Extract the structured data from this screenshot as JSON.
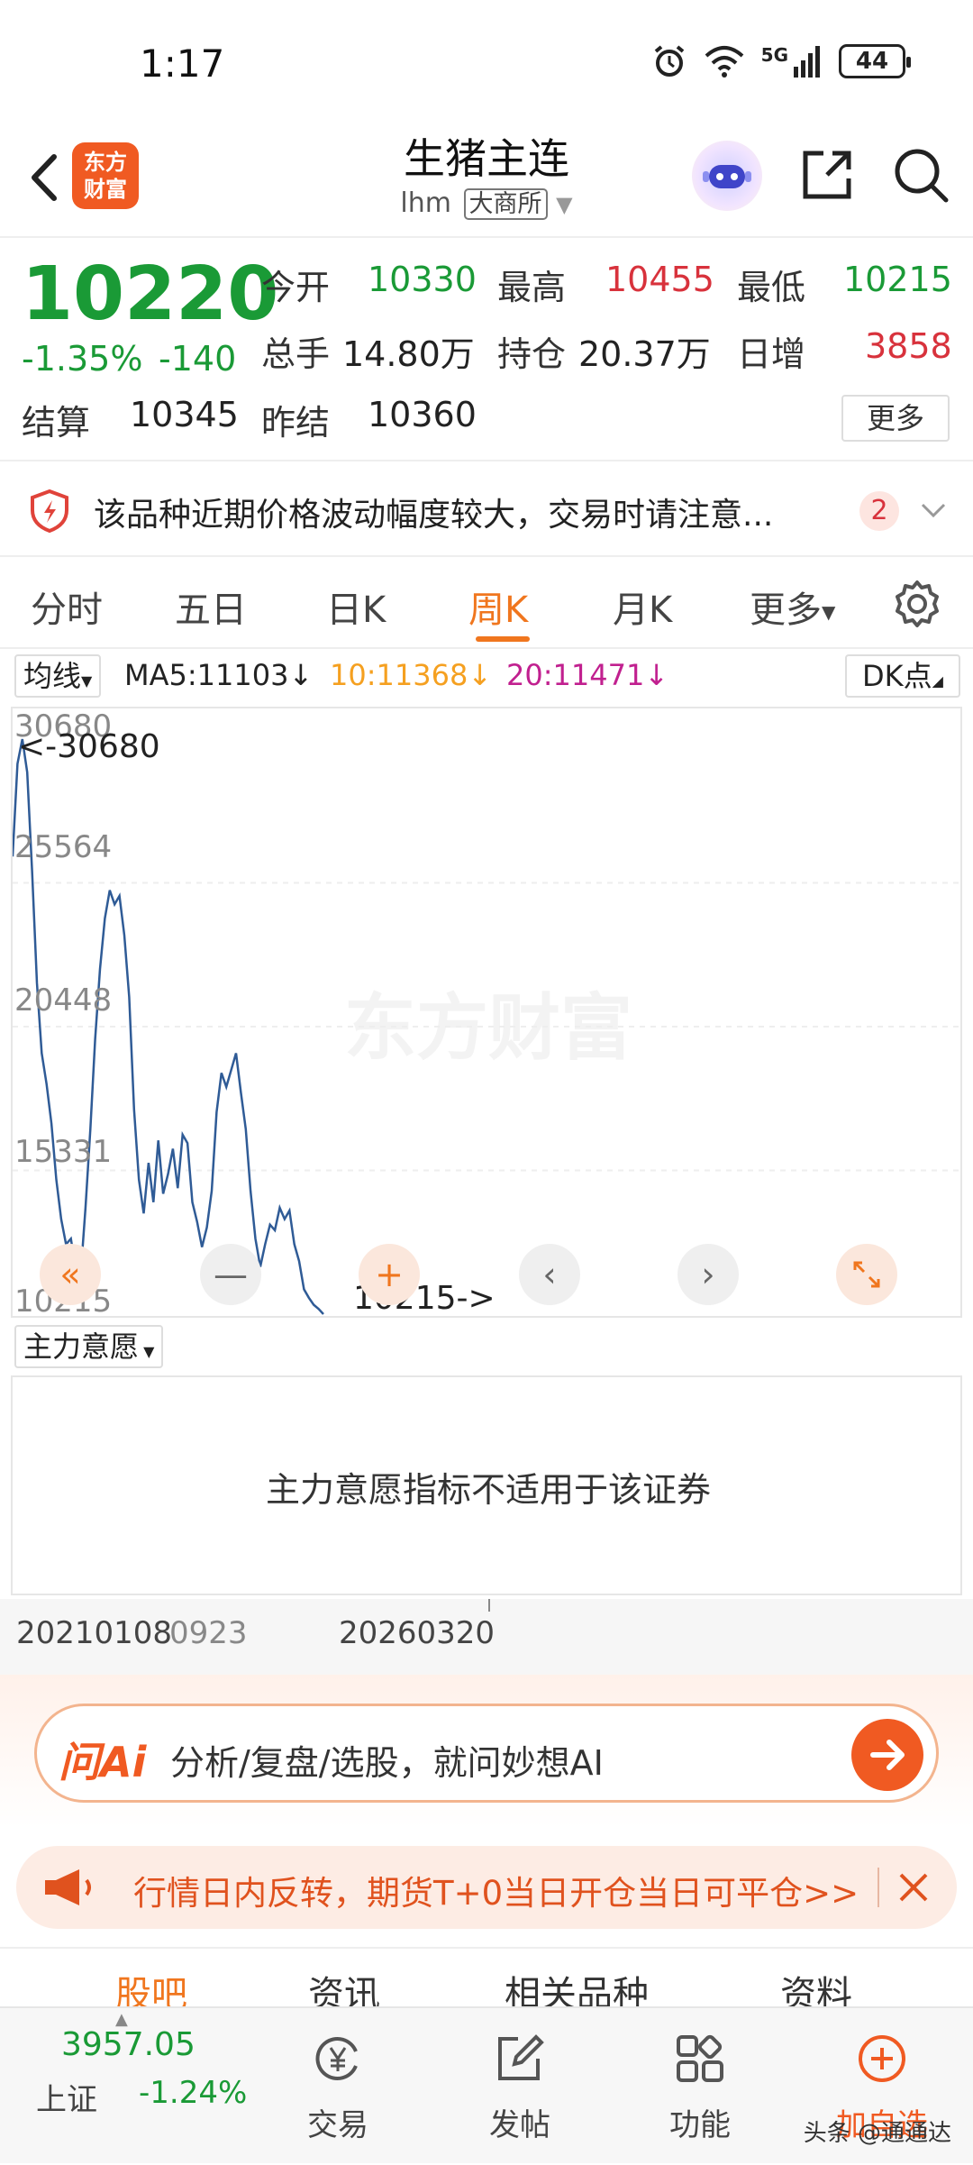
{
  "status_bar": {
    "time": "1:17",
    "network": "5G",
    "battery": "44"
  },
  "header": {
    "back_icon": "chevron-left-icon",
    "logo_text_top": "东方",
    "logo_text_bottom": "财富",
    "title": "生猪主连",
    "code": "lhm",
    "exchange": "大商所",
    "avatar_icon": "robot-avatar-icon",
    "share_icon": "share-icon",
    "search_icon": "search-icon"
  },
  "quote": {
    "last_price": "10220",
    "change_pct": "-1.35%",
    "change_abs": "-140",
    "open_label": "今开",
    "open": "10330",
    "high_label": "最高",
    "high": "10455",
    "low_label": "最低",
    "low": "10215",
    "volume_label": "总手",
    "volume": "14.80万",
    "oi_label": "持仓",
    "oi": "20.37万",
    "daily_inc_label": "日增",
    "daily_inc": "3858",
    "settle_label": "结算",
    "settle": "10345",
    "prev_settle_label": "昨结",
    "prev_settle": "10360",
    "more_label": "更多"
  },
  "risk_notice": {
    "text": "该品种近期价格波动幅度较大，交易时请注意...",
    "count": "2"
  },
  "period_tabs": [
    "分时",
    "五日",
    "日K",
    "周K",
    "月K",
    "更多"
  ],
  "active_tab": "周K",
  "ma": {
    "select_label": "均线",
    "ma5": "MA5:11103↓",
    "ma10": "10:11368↓",
    "ma20": "20:11471↓",
    "dk_label": "DK点"
  },
  "chart_data": {
    "type": "line",
    "watermark": "东方财富",
    "y_ticks": [
      "30680",
      "25564",
      "20448",
      "15331",
      "10215"
    ],
    "ylim": [
      10215,
      30680
    ],
    "max_annotation": "<-30680",
    "min_annotation": "10215->",
    "x_start_label": "20210108",
    "x_end_label": "20260320",
    "series": [
      {
        "values": [
          26500,
          29800,
          30680,
          29500,
          26000,
          22000,
          19500,
          18400,
          17000,
          15000,
          13600,
          12700,
          12900,
          11800,
          11600,
          14000,
          16800,
          20000,
          22500,
          24300,
          25300,
          24800,
          25100,
          23700,
          21500,
          17500,
          15000,
          13800,
          15600,
          14200,
          16400,
          14500,
          15200,
          16100,
          14700,
          16600,
          16300,
          14200,
          13500,
          12600,
          13300,
          14600,
          17400,
          18800,
          18300,
          18900,
          19500,
          18100,
          16800,
          14600,
          12900,
          11900,
          12700,
          13400,
          13200,
          14000,
          13600,
          13900,
          12700,
          12100,
          11100,
          10800,
          10550,
          10400,
          10215
        ]
      }
    ]
  },
  "chart_controls": {
    "rewind_icon": "double-chevron-left-icon",
    "zoom_out_icon": "minus-icon",
    "zoom_in_icon": "plus-icon",
    "prev_icon": "chevron-left-icon",
    "next_icon": "chevron-right-icon",
    "fullscreen_icon": "expand-icon"
  },
  "indicator": {
    "select_label": "主力意愿",
    "message": "主力意愿指标不适用于该证券"
  },
  "date_axis": {
    "start": "20210108",
    "mid": "0923",
    "end": "20260320"
  },
  "ai_bar": {
    "logo": "问Ai",
    "placeholder": "分析/复盘/选股，就问妙想AI"
  },
  "promo": {
    "text": "行情日内反转，期货T+0当日开仓当日可平仓>>"
  },
  "content_tabs": [
    "股吧",
    "资讯",
    "相关品种",
    "资料"
  ],
  "bottom_bar": {
    "index_value": "3957.05",
    "index_name": "上证",
    "index_change": "-1.24%",
    "trade_label": "交易",
    "post_label": "发帖",
    "func_label": "功能",
    "add_label": "加自选",
    "attribution": "头条 @通通达"
  }
}
